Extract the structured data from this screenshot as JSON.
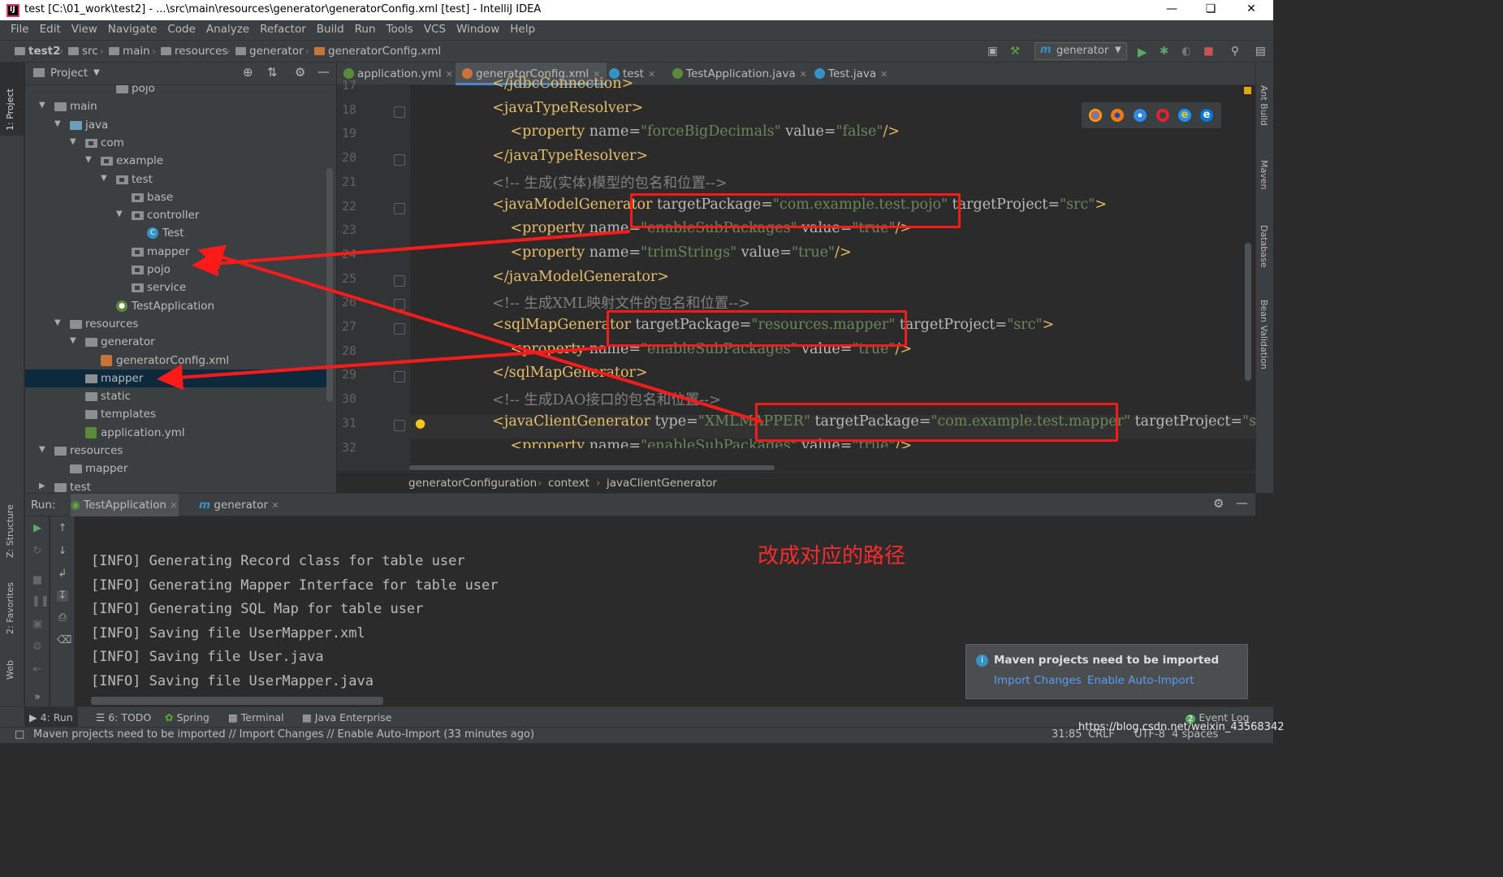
{
  "window": {
    "title": "test [C:\\01_work\\test2] - ...\\src\\main\\resources\\generator\\generatorConfig.xml [test] - IntelliJ IDEA",
    "app_icon_text": "IJ"
  },
  "menu": [
    "File",
    "Edit",
    "View",
    "Navigate",
    "Code",
    "Analyze",
    "Refactor",
    "Build",
    "Run",
    "Tools",
    "VCS",
    "Window",
    "Help"
  ],
  "nav_crumbs": [
    "test2",
    "src",
    "main",
    "resources",
    "generator",
    "generatorConfig.xml"
  ],
  "run_config": "generator",
  "left_strip": {
    "project": "1: Project",
    "structure": "Z: Structure",
    "favorites": "2: Favorites",
    "web": "Web"
  },
  "right_strip": {
    "ant": "Ant Build",
    "maven": "Maven",
    "database": "Database",
    "bean": "Bean Validation"
  },
  "project_panel": {
    "title": "Project"
  },
  "tree": [
    {
      "label": "pojo",
      "depth": 6,
      "icon": "folder",
      "expand": ""
    },
    {
      "label": "main",
      "depth": 2,
      "icon": "folder",
      "expand": "open"
    },
    {
      "label": "java",
      "depth": 3,
      "icon": "src",
      "expand": "open"
    },
    {
      "label": "com",
      "depth": 4,
      "icon": "pkg",
      "expand": "open"
    },
    {
      "label": "example",
      "depth": 5,
      "icon": "pkg",
      "expand": "open"
    },
    {
      "label": "test",
      "depth": 6,
      "icon": "pkg",
      "expand": "open"
    },
    {
      "label": "base",
      "depth": 7,
      "icon": "pkg",
      "expand": ""
    },
    {
      "label": "controller",
      "depth": 7,
      "icon": "pkg",
      "expand": "open"
    },
    {
      "label": "Test",
      "depth": 8,
      "icon": "class",
      "expand": ""
    },
    {
      "label": "mapper",
      "depth": 7,
      "icon": "pkg",
      "expand": ""
    },
    {
      "label": "pojo",
      "depth": 7,
      "icon": "pkg",
      "expand": ""
    },
    {
      "label": "service",
      "depth": 7,
      "icon": "pkg",
      "expand": ""
    },
    {
      "label": "TestApplication",
      "depth": 6,
      "icon": "spring",
      "expand": ""
    },
    {
      "label": "resources",
      "depth": 3,
      "icon": "res",
      "expand": "open"
    },
    {
      "label": "generator",
      "depth": 4,
      "icon": "folder",
      "expand": "open"
    },
    {
      "label": "generatorConfig.xml",
      "depth": 5,
      "icon": "xml",
      "expand": ""
    },
    {
      "label": "mapper",
      "depth": 4,
      "icon": "folder",
      "expand": "",
      "selected": true
    },
    {
      "label": "static",
      "depth": 4,
      "icon": "folder",
      "expand": ""
    },
    {
      "label": "templates",
      "depth": 4,
      "icon": "folder",
      "expand": ""
    },
    {
      "label": "application.yml",
      "depth": 4,
      "icon": "yml",
      "expand": ""
    },
    {
      "label": "resources",
      "depth": 2,
      "icon": "folder",
      "expand": "open"
    },
    {
      "label": "mapper",
      "depth": 3,
      "icon": "folder",
      "expand": ""
    },
    {
      "label": "test",
      "depth": 2,
      "icon": "folder",
      "expand": "closed"
    }
  ],
  "editor_tabs": [
    {
      "label": "application.yml",
      "icon_color": "#5a8a3a"
    },
    {
      "label": "generatorConfig.xml",
      "icon_color": "#c9733a",
      "active": true
    },
    {
      "label": "test",
      "icon_color": "#3592c4"
    },
    {
      "label": "TestApplication.java",
      "icon_color": "#5a8a3a"
    },
    {
      "label": "Test.java",
      "icon_color": "#3592c4"
    }
  ],
  "code_lines": [
    {
      "n": "17",
      "parts": [
        [
          "t",
          "    </jdbcConnection>"
        ]
      ]
    },
    {
      "n": "18",
      "parts": [
        [
          "t",
          "    <javaTypeResolver>"
        ]
      ]
    },
    {
      "n": "19",
      "parts": [
        [
          "t",
          "        <property "
        ],
        [
          "a",
          "name="
        ],
        [
          "v",
          "\"forceBigDecimals\""
        ],
        [
          "a",
          " value="
        ],
        [
          "v",
          "\"false\""
        ],
        [
          "t",
          "/>"
        ]
      ]
    },
    {
      "n": "20",
      "parts": [
        [
          "t",
          "    </javaTypeResolver>"
        ]
      ]
    },
    {
      "n": "21",
      "parts": [
        [
          "c",
          "    <!-- 生成(实体)模型的包名和位置-->"
        ]
      ]
    },
    {
      "n": "22",
      "parts": [
        [
          "t",
          "    <javaModelGenerator "
        ],
        [
          "a",
          "targetPackage="
        ],
        [
          "v",
          "\"com.example.test.pojo\""
        ],
        [
          "a",
          " targetProject="
        ],
        [
          "v",
          "\"src\""
        ],
        [
          "t",
          ">"
        ]
      ]
    },
    {
      "n": "23",
      "parts": [
        [
          "t",
          "        <property "
        ],
        [
          "a",
          "name="
        ],
        [
          "v",
          "\"enableSubPackages\""
        ],
        [
          "a",
          " value="
        ],
        [
          "v",
          "\"true\""
        ],
        [
          "t",
          "/>"
        ]
      ]
    },
    {
      "n": "24",
      "parts": [
        [
          "t",
          "        <property "
        ],
        [
          "a",
          "name="
        ],
        [
          "v",
          "\"trimStrings\""
        ],
        [
          "a",
          " value="
        ],
        [
          "v",
          "\"true\""
        ],
        [
          "t",
          "/>"
        ]
      ]
    },
    {
      "n": "25",
      "parts": [
        [
          "t",
          "    </javaModelGenerator>"
        ]
      ]
    },
    {
      "n": "26",
      "parts": [
        [
          "c",
          "    <!-- 生成XML映射文件的包名和位置-->"
        ]
      ]
    },
    {
      "n": "27",
      "parts": [
        [
          "t",
          "    <sqlMapGenerator "
        ],
        [
          "a",
          "targetPackage="
        ],
        [
          "v",
          "\"resources.mapper\""
        ],
        [
          "a",
          " targetProject="
        ],
        [
          "v",
          "\"src\""
        ],
        [
          "t",
          ">"
        ]
      ]
    },
    {
      "n": "28",
      "parts": [
        [
          "t",
          "        <property "
        ],
        [
          "a",
          "name="
        ],
        [
          "v",
          "\"enableSubPackages\""
        ],
        [
          "a",
          " value="
        ],
        [
          "v",
          "\"true\""
        ],
        [
          "t",
          "/>"
        ]
      ]
    },
    {
      "n": "29",
      "parts": [
        [
          "t",
          "    </sqlMapGenerator>"
        ]
      ]
    },
    {
      "n": "30",
      "parts": [
        [
          "c",
          "    <!-- 生成DAO接口的包名和位置-->"
        ]
      ]
    },
    {
      "n": "31",
      "parts": [
        [
          "t",
          "    <javaClientGenerator "
        ],
        [
          "a",
          "type="
        ],
        [
          "v",
          "\"XMLMAPPER\""
        ],
        [
          "a",
          " targetPackage="
        ],
        [
          "v",
          "\"com.example.test.mapper\""
        ],
        [
          "a",
          " targetProject="
        ],
        [
          "v",
          "\"sr"
        ]
      ]
    },
    {
      "n": "32",
      "parts": [
        [
          "t",
          "        <property "
        ],
        [
          "a",
          "name="
        ],
        [
          "v",
          "\"enableSubPackages\""
        ],
        [
          "a",
          " value="
        ],
        [
          "v",
          "\"true\""
        ],
        [
          "t",
          "/>"
        ]
      ]
    }
  ],
  "editor_breadcrumb": [
    "generatorConfiguration",
    "context",
    "javaClientGenerator"
  ],
  "run_panel": {
    "label": "Run:",
    "tabs": [
      "TestApplication",
      "generator"
    ],
    "log": [
      "[INFO] Generating Record class for table user",
      "[INFO] Generating Mapper Interface for table user",
      "[INFO] Generating SQL Map for table user",
      "[INFO] Saving file UserMapper.xml",
      "[INFO] Saving file User.java",
      "[INFO] Saving file UserMapper.java"
    ],
    "log_partial": "[INFO]"
  },
  "annotation": "改成对应的路径",
  "notification": {
    "message": "Maven projects need to be imported",
    "link_import": "Import Changes",
    "link_auto": "Enable Auto-Import"
  },
  "bottom_tabs": [
    "4: Run",
    "6: TODO",
    "Spring",
    "Terminal",
    "Java Enterprise",
    "Event Log"
  ],
  "status": {
    "message": "Maven projects need to be imported // Import Changes // Enable Auto-Import (33 minutes ago)",
    "position": "31:85",
    "line_sep": "CRLF",
    "encoding": "UTF-8",
    "indent": "4 spaces",
    "watermark": "https://blog.csdn.net/weixin_43568342"
  },
  "colors": {
    "accent": "#4a88c7",
    "annotation_red": "#ff1a1a",
    "link": "#589df6"
  }
}
